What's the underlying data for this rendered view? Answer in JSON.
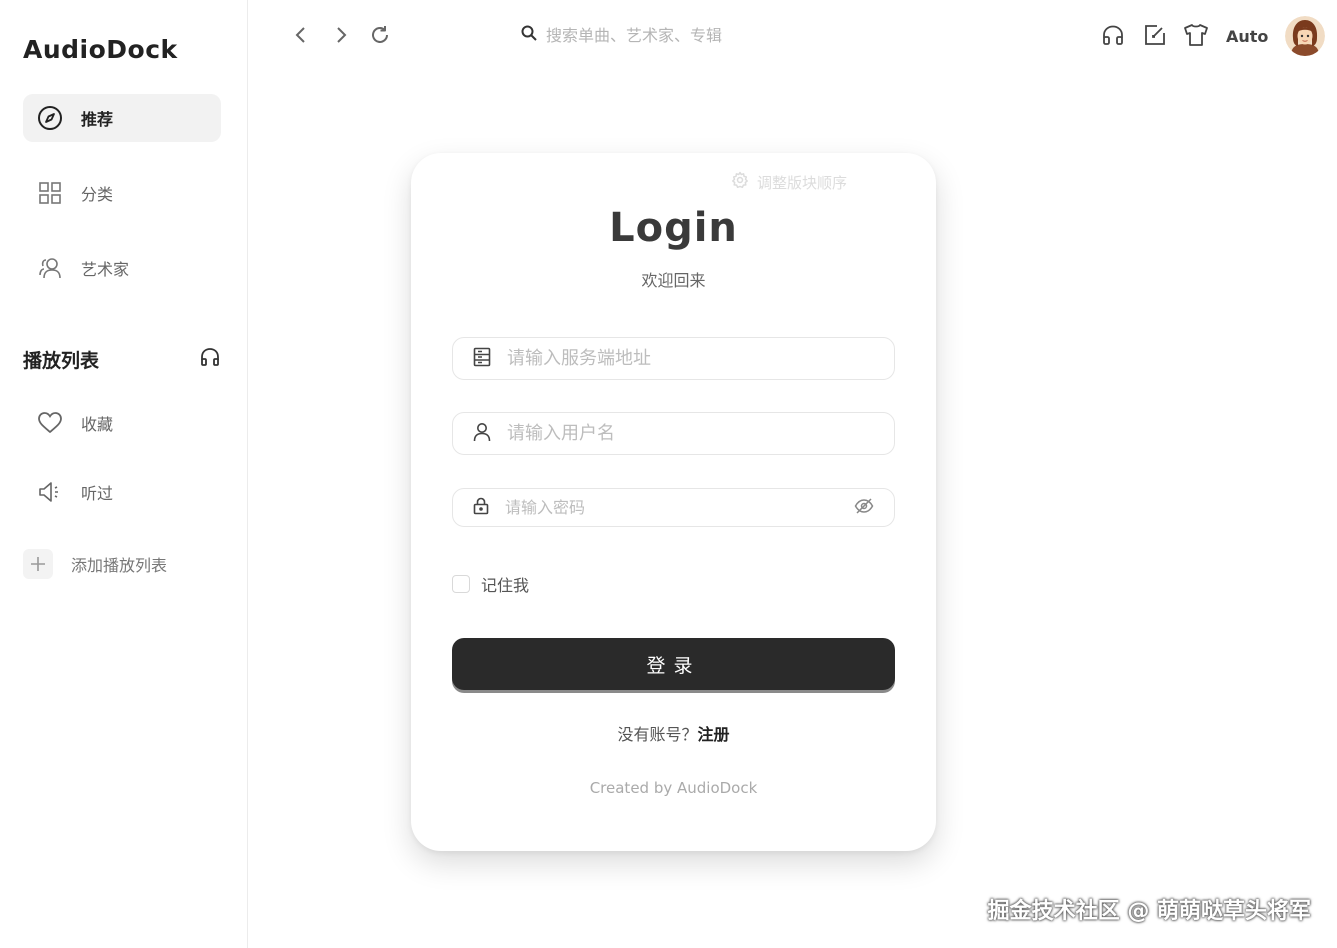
{
  "app": {
    "name": "AudioDock"
  },
  "sidebar": {
    "nav": [
      {
        "label": "推荐",
        "icon": "compass-icon",
        "active": true
      },
      {
        "label": "分类",
        "icon": "grid-icon",
        "active": false
      },
      {
        "label": "艺术家",
        "icon": "users-icon",
        "active": false
      }
    ],
    "playlist_section": {
      "title": "播放列表",
      "icon": "headphones-icon"
    },
    "playlist_items": [
      {
        "label": "收藏",
        "icon": "heart-icon"
      },
      {
        "label": "听过",
        "icon": "speaker-icon"
      }
    ],
    "add_playlist_label": "添加播放列表"
  },
  "topbar": {
    "search_placeholder": "搜索单曲、艺术家、专辑",
    "theme_label": "Auto",
    "icons": [
      "back-icon",
      "forward-icon",
      "refresh-icon",
      "headphones-icon",
      "external-edit-icon",
      "shirt-icon"
    ]
  },
  "login": {
    "reorder_label": "调整版块顺序",
    "title": "Login",
    "subtitle": "欢迎回来",
    "server_placeholder": "请输入服务端地址",
    "username_placeholder": "请输入用户名",
    "password_placeholder": "请输入密码",
    "remember_label": "记住我",
    "submit_label": "登录",
    "no_account_text": "没有账号？",
    "register_link": "注册",
    "credit": "Created by AudioDock"
  },
  "watermark": "掘金技术社区 @ 萌萌哒草头将军",
  "colors": {
    "accent": "#2a2a2a",
    "background": "#ffffff",
    "active_nav_bg": "#f2f2f2"
  }
}
